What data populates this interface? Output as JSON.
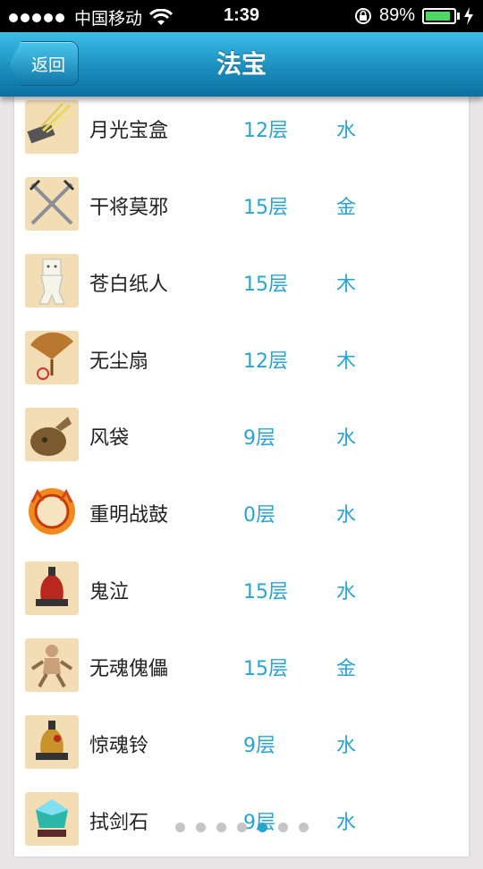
{
  "status_bar": {
    "carrier": "中国移动",
    "time": "1:39",
    "battery_percent": "89%",
    "battery_level": 0.89,
    "signal_dots": 5
  },
  "nav": {
    "back_label": "返回",
    "title": "法宝"
  },
  "items": [
    {
      "name": "月光宝盒",
      "layer": "12层",
      "element": "水",
      "icon": "moonlight-box-icon"
    },
    {
      "name": "干将莫邪",
      "layer": "15层",
      "element": "金",
      "icon": "crossed-swords-icon"
    },
    {
      "name": "苍白纸人",
      "layer": "15层",
      "element": "木",
      "icon": "paper-doll-icon"
    },
    {
      "name": "无尘扇",
      "layer": "12层",
      "element": "木",
      "icon": "fan-icon"
    },
    {
      "name": "风袋",
      "layer": "9层",
      "element": "水",
      "icon": "wind-bag-icon"
    },
    {
      "name": "重明战鼓",
      "layer": "0层",
      "element": "水",
      "icon": "war-drum-icon"
    },
    {
      "name": "鬼泣",
      "layer": "15层",
      "element": "水",
      "icon": "red-bell-icon"
    },
    {
      "name": "无魂傀儡",
      "layer": "15层",
      "element": "金",
      "icon": "puppet-icon"
    },
    {
      "name": "惊魂铃",
      "layer": "9层",
      "element": "水",
      "icon": "bell-icon"
    },
    {
      "name": "拭剑石",
      "layer": "9层",
      "element": "水",
      "icon": "gem-stone-icon"
    }
  ],
  "pager": {
    "count": 7,
    "active_index": 4
  }
}
